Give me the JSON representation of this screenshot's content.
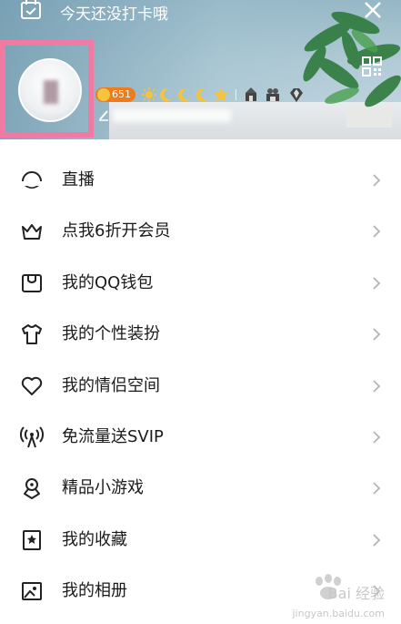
{
  "header": {
    "checkin_text": "今天还没打卡哦",
    "level": "651"
  },
  "menu": [
    {
      "label": "直播",
      "icon": "live-icon"
    },
    {
      "label": "点我6折开会员",
      "icon": "crown-icon"
    },
    {
      "label": "我的QQ钱包",
      "icon": "wallet-icon"
    },
    {
      "label": "我的个性装扮",
      "icon": "tshirt-icon"
    },
    {
      "label": "我的情侣空间",
      "icon": "heart-icon"
    },
    {
      "label": "免流量送SVIP",
      "icon": "signal-tower-icon"
    },
    {
      "label": "精品小游戏",
      "icon": "game-icon"
    },
    {
      "label": "我的收藏",
      "icon": "bookmark-icon"
    },
    {
      "label": "我的相册",
      "icon": "album-icon"
    }
  ],
  "watermark": {
    "text": "Bai 经验",
    "url": "jingyan.baidu.com"
  },
  "colors": {
    "highlight_border": "#f07aa3",
    "level_badge": "#ef7c1b",
    "text": "#1a1a1a",
    "chevron": "#b3b3b3"
  }
}
